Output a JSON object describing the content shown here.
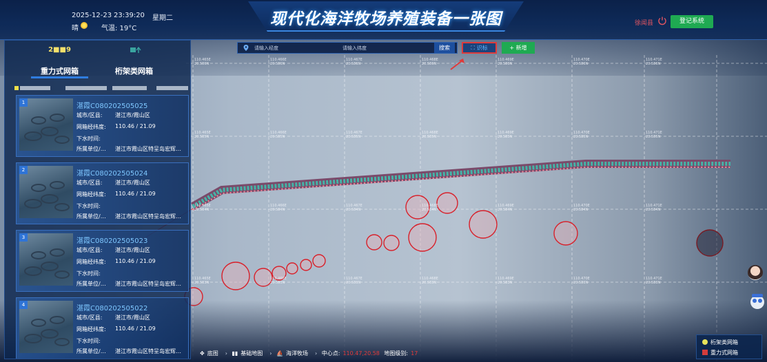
{
  "header": {
    "date": "2025-12-23",
    "time": "23:39:20",
    "weekday": "星期二",
    "weather": "晴",
    "temperature": "气温: 19°C",
    "title": "现代化海洋牧场养殖装备一张图",
    "user": "徐闻县",
    "login_button": "登记系统"
  },
  "search": {
    "lon_placeholder": "请输入经度",
    "lat_placeholder": "请输入纬度",
    "search_button": "搜索",
    "recognize_button": "识标",
    "add_button": "+ 新增"
  },
  "left_panel": {
    "tabs": [
      {
        "label": "重力式网箱",
        "count": "2■■9"
      },
      {
        "label": "桁架类网箱",
        "count": ""
      }
    ],
    "cards": [
      {
        "index": "1",
        "code": "湛霞C080202505025",
        "city_label": "城市/区县:",
        "city": "湛江市/霞山区",
        "coord_label": "网箱经纬度:",
        "coord": "110.46 / 21.09",
        "drop_label": "下水时间:",
        "drop": "",
        "unit_label": "所属单位/…",
        "unit": "湛江市霞山区特呈岛宏辉…"
      },
      {
        "index": "2",
        "code": "湛霞C080202505024",
        "city_label": "城市/区县:",
        "city": "湛江市/霞山区",
        "coord_label": "网箱经纬度:",
        "coord": "110.46 / 21.09",
        "drop_label": "下水时间:",
        "drop": "",
        "unit_label": "所属单位/…",
        "unit": "湛江市霞山区特呈岛宏辉…"
      },
      {
        "index": "3",
        "code": "湛霞C080202505023",
        "city_label": "城市/区县:",
        "city": "湛江市/霞山区",
        "coord_label": "网箱经纬度:",
        "coord": "110.46 / 21.09",
        "drop_label": "下水时间:",
        "drop": "",
        "unit_label": "所属单位/…",
        "unit": "湛江市霞山区特呈岛宏辉…"
      },
      {
        "index": "4",
        "code": "湛霞C080202505022",
        "city_label": "城市/区县:",
        "city": "湛江市/霞山区",
        "coord_label": "网箱经纬度:",
        "coord": "110.46 / 21.09",
        "drop_label": "下水时间:",
        "drop": "",
        "unit_label": "所属单位/…",
        "unit": "湛江市霞山区特呈岛宏辉…"
      }
    ]
  },
  "map": {
    "grid_labels": {
      "lon": [
        "110.465E",
        "110.466E",
        "110.467E",
        "110.468E",
        "110.469E",
        "110.470E",
        "110.471E"
      ],
      "lat": [
        "20.586N",
        "20.585N",
        "20.584N",
        "20.583N"
      ]
    }
  },
  "bottom_bar": {
    "basemap": "底图",
    "basic_map": "基础地图",
    "ocean_ranch": "海洋牧场",
    "center_label": "中心点:",
    "center_value": "110.47,20.58",
    "zoom_label": "地图级别:",
    "zoom_value": "17"
  },
  "legend": {
    "truss": "桁架类网箱",
    "gravity": "重力式网箱",
    "truss_color": "#e8e25a",
    "gravity_color": "#d43c3c"
  },
  "colors": {
    "accent": "#2f7de0",
    "success": "#1faa52",
    "alert": "#e03a3a",
    "card_code": "#7ec7ff"
  }
}
